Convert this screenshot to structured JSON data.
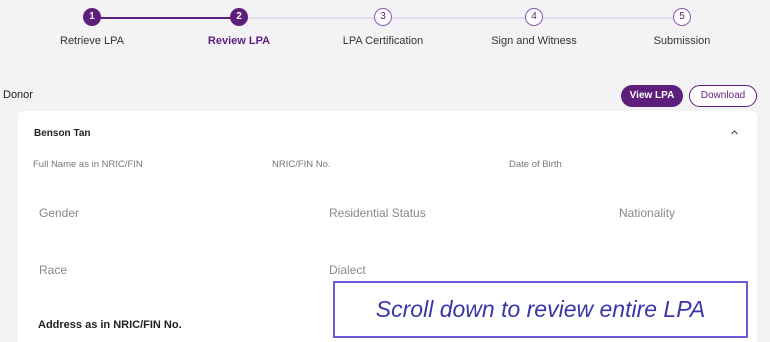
{
  "stepper": {
    "steps": [
      {
        "number": "1",
        "label": "Retrieve LPA",
        "state": "done"
      },
      {
        "number": "2",
        "label": "Review LPA",
        "state": "active"
      },
      {
        "number": "3",
        "label": "LPA Certification",
        "state": "pending"
      },
      {
        "number": "4",
        "label": "Sign and Witness",
        "state": "pending"
      },
      {
        "number": "5",
        "label": "Submission",
        "state": "pending"
      }
    ]
  },
  "section": {
    "title": "Donor",
    "view_button": "View LPA",
    "download_button": "Download"
  },
  "card": {
    "name": "Benson Tan",
    "fields_row1": [
      "Full Name as in NRIC/FIN",
      "NRIC/FIN No.",
      "Date of Birth"
    ],
    "fields_row2": [
      "Gender",
      "Residential Status",
      "Nationality"
    ],
    "fields_row3": [
      "Race",
      "Dialect"
    ],
    "address_label": "Address as in NRIC/FIN No."
  },
  "callout": {
    "text": "Scroll down to review entire LPA"
  },
  "colors": {
    "accent": "#5e1f7c",
    "callout_border": "#6b5bd4",
    "callout_text": "#3a37a6"
  },
  "icons": {
    "collapse": "chevron-up-icon"
  }
}
